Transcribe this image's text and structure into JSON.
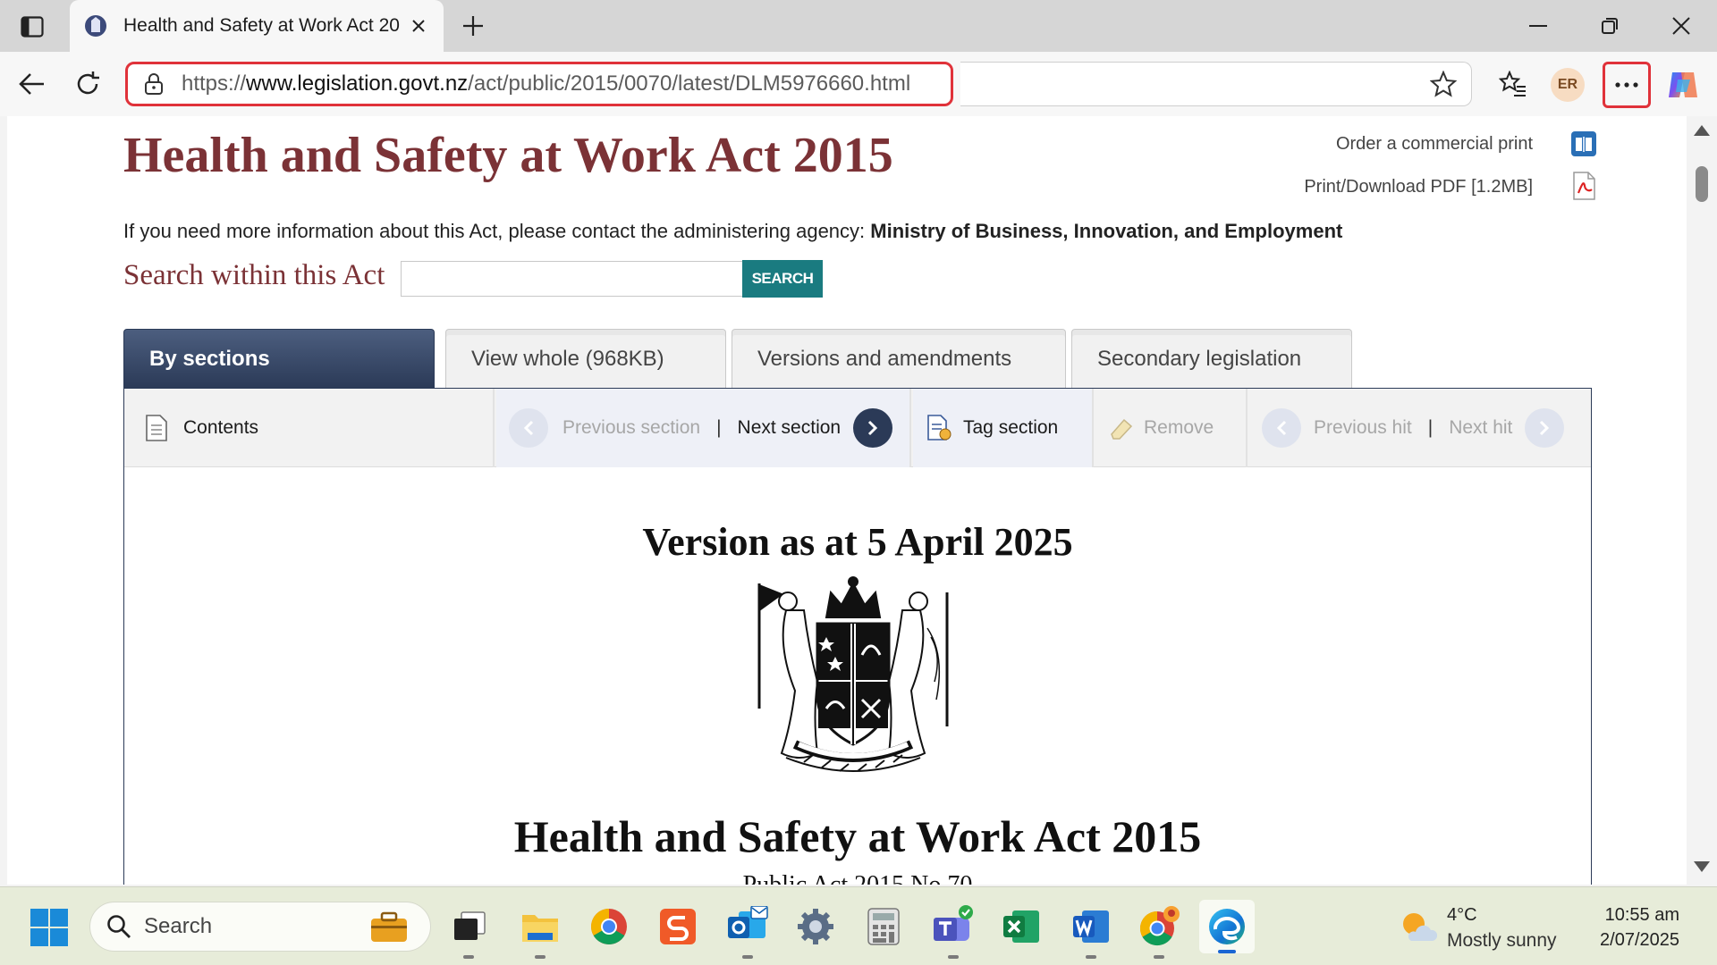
{
  "browser": {
    "tab_title": "Health and Safety at Work Act 20",
    "url_scheme": "https://",
    "url_host": "www.legislation.govt.nz",
    "url_path": "/act/public/2015/0070/latest/DLM5976660.html",
    "profile_initials": "ER"
  },
  "page": {
    "title": "Health and Safety at Work Act 2015",
    "order_print_link": "Order a commercial print",
    "pdf_link": "Print/Download PDF [1.2MB]",
    "agency_text": "If you need more information about this Act, please contact the administering agency: ",
    "agency_name": "Ministry of Business, Innovation, and Employment",
    "search_label": "Search within this Act",
    "search_value": "",
    "search_button": "SEARCH",
    "tabs": [
      {
        "label": "By sections",
        "active": true
      },
      {
        "label": "View whole (968KB)",
        "active": false
      },
      {
        "label": "Versions and amendments",
        "active": false
      },
      {
        "label": "Secondary legislation",
        "active": false
      }
    ],
    "nav": {
      "contents": "Contents",
      "previous_section": "Previous section",
      "separator": "|",
      "next_section": "Next section",
      "tag_section": "Tag section",
      "remove": "Remove",
      "previous_hit": "Previous hit",
      "next_hit": "Next hit"
    },
    "version_heading": "Version as at 5 April 2025",
    "act_heading": "Health and Safety at Work Act 2015",
    "act_subheading": "Public Act   2015 No 70"
  },
  "taskbar": {
    "search_label": "Search",
    "weather_temp": "4°C",
    "weather_desc": "Mostly sunny",
    "time": "10:55 am",
    "date": "2/07/2025"
  },
  "colors": {
    "title_maroon": "#7b3236",
    "tab_navy": "#2b3a57",
    "search_teal": "#1a7b80",
    "highlight_red": "#e0323a"
  }
}
